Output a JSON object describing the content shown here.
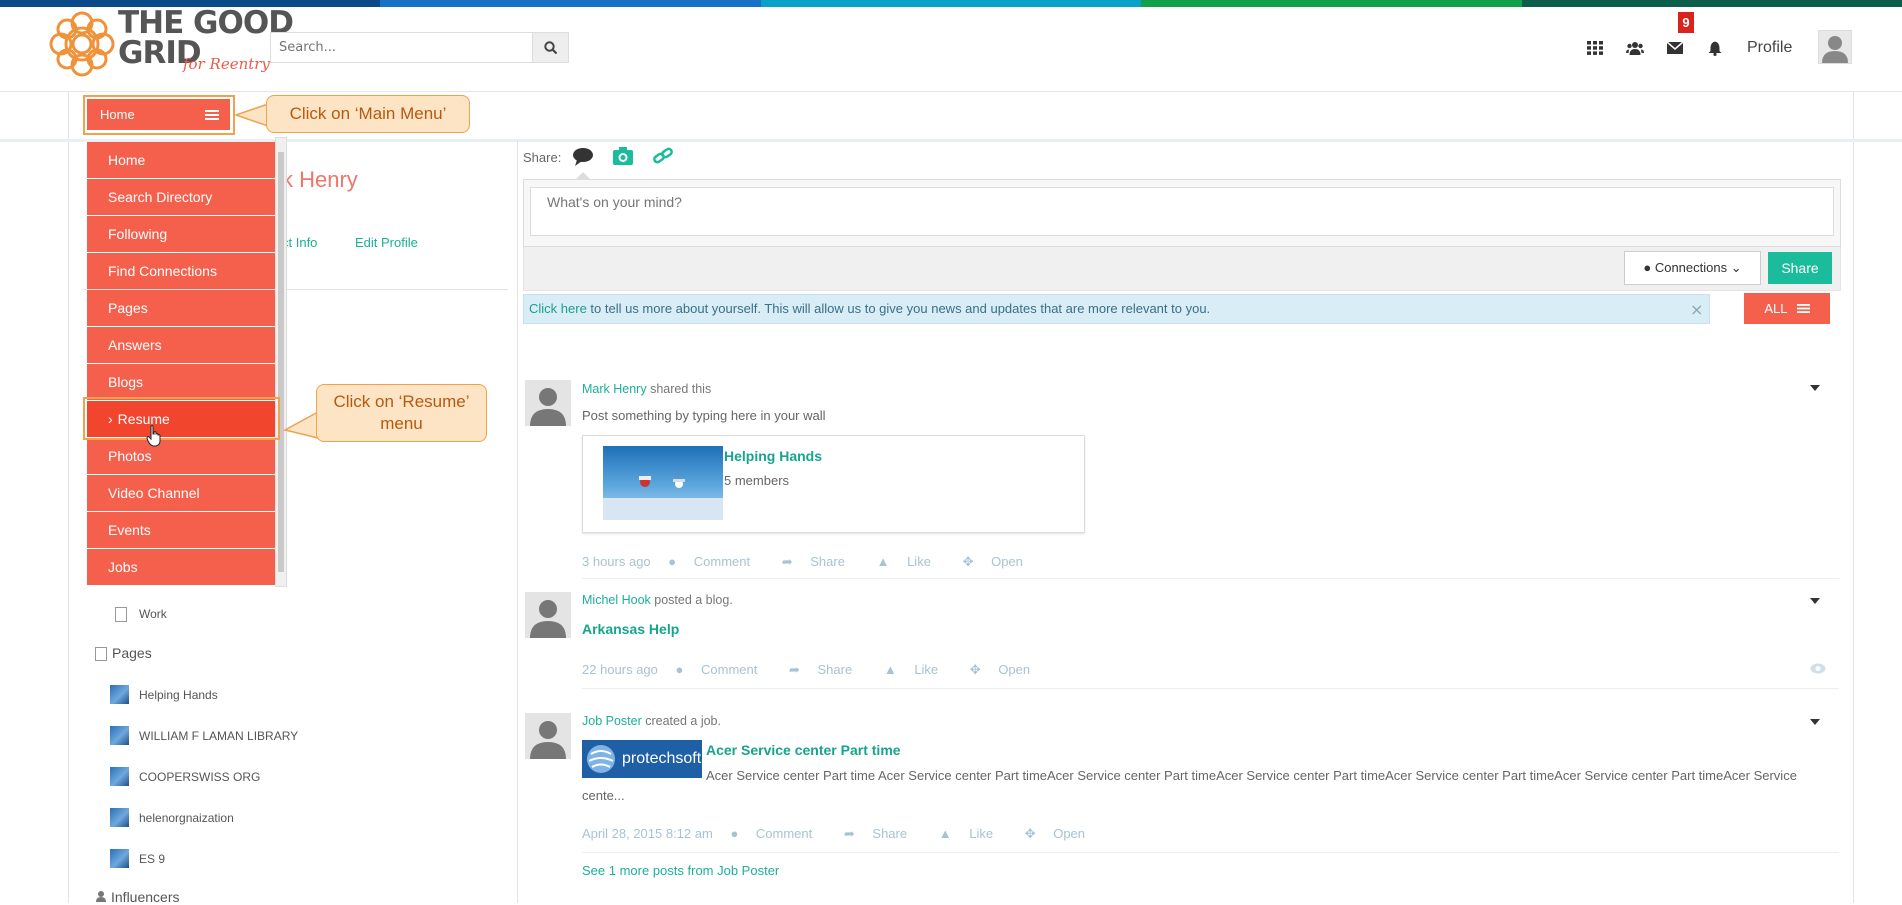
{
  "header": {
    "logo_top": "THE GOOD",
    "logo_bottom": "GRID",
    "logo_tag": "for Reentry",
    "search_placeholder": "Search...",
    "notification_count": "9",
    "profile_label": "Profile"
  },
  "stripe_colors": [
    "#0a4a8a",
    "#1672c9",
    "#0aa0c8",
    "#12a04a",
    "#0c5e4a"
  ],
  "home_button_label": "Home",
  "callouts": {
    "main_menu": "Click on ‘Main Menu’",
    "resume_line1": "Click on ‘Resume’",
    "resume_line2": "menu"
  },
  "menu": [
    {
      "label": "Home"
    },
    {
      "label": "Search Directory"
    },
    {
      "label": "Following"
    },
    {
      "label": "Find Connections"
    },
    {
      "label": "Pages"
    },
    {
      "label": "Answers"
    },
    {
      "label": "Blogs"
    },
    {
      "label": "Resume",
      "active": true
    },
    {
      "label": "Photos"
    },
    {
      "label": "Video Channel"
    },
    {
      "label": "Events"
    },
    {
      "label": "Jobs"
    }
  ],
  "left": {
    "name_partial": "k Henry",
    "contact_partial": "ct Info",
    "edit_profile": "Edit Profile",
    "work": "Work",
    "pages_header": "Pages",
    "pages": [
      "Helping Hands",
      "WILLIAM F LAMAN LIBRARY",
      "COOPERSWISS ORG",
      "helenorgnaization",
      "ES 9"
    ],
    "influencers_header": "Influencers"
  },
  "composer": {
    "share_label": "Share:",
    "placeholder": "What's on your mind?",
    "connections_label": "Connections",
    "share_button": "Share"
  },
  "info_bar": {
    "link": "Click here",
    "text": " to tell us more about yourself. This will allow us to give you news and updates that are more relevant to you.",
    "close": "×"
  },
  "all_button": "ALL",
  "posts": [
    {
      "author": "Mark Henry",
      "action": " shared this",
      "body": "Post something by typing here in your wall",
      "card_title": "Helping Hands",
      "card_sub": "5 members",
      "time": "3 hours ago"
    },
    {
      "author": "Michel Hook",
      "action": " posted a blog.",
      "title": "Arkansas Help",
      "time": "22 hours ago"
    },
    {
      "author": "Job Poster",
      "action": " created a job.",
      "logo_text": "protechsoft",
      "title": "Acer Service center Part time",
      "body": "Acer  Service center Part time Acer  Service center Part timeAcer  Service center Part timeAcer  Service center Part timeAcer  Service center Part timeAcer  Service center Part timeAcer  Service cente...",
      "time": "April 28, 2015 8:12 am",
      "more": "See 1 more posts from Job Poster"
    }
  ],
  "actions": {
    "comment": "Comment",
    "share": "Share",
    "like": "Like",
    "open": "Open"
  }
}
